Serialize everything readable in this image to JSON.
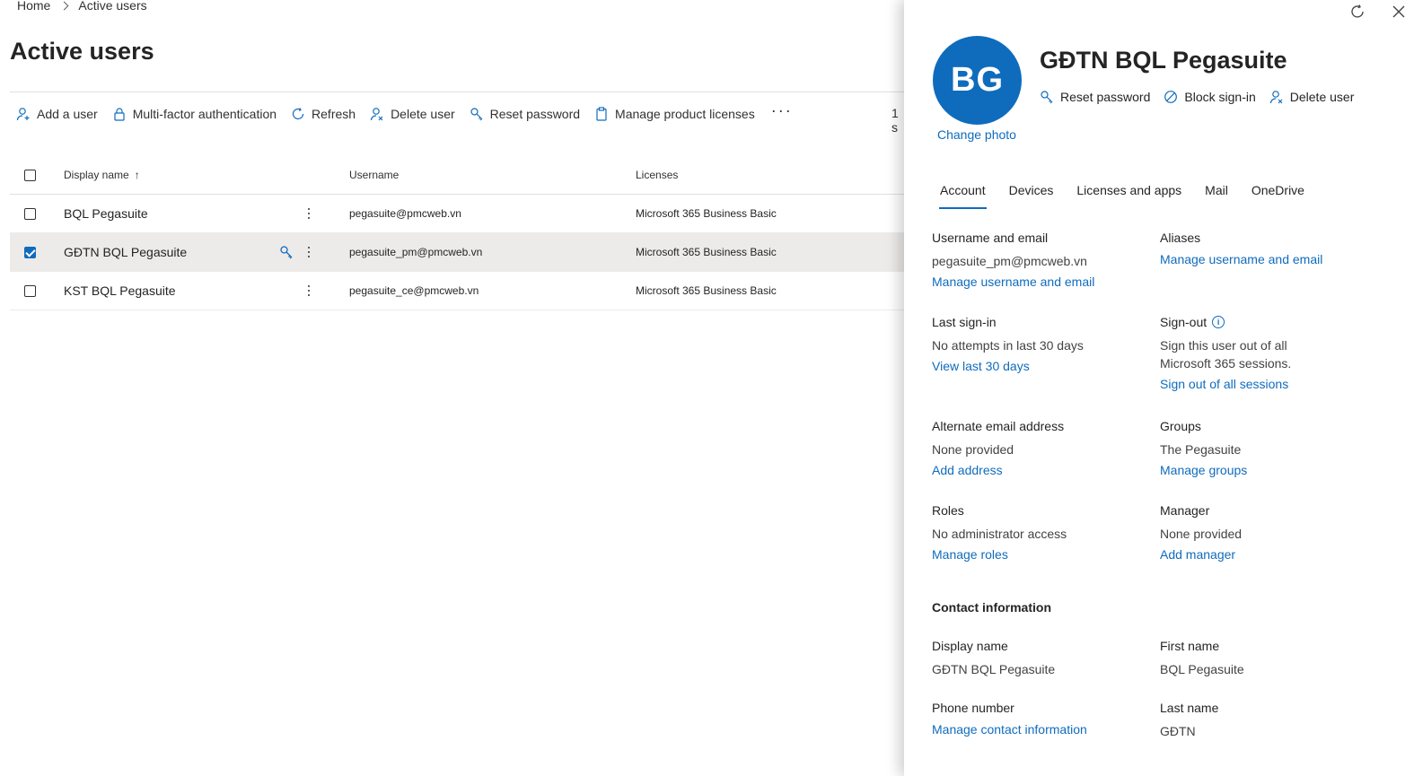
{
  "breadcrumb": {
    "home": "Home",
    "current": "Active users"
  },
  "page": {
    "title": "Active users"
  },
  "toolbar": {
    "add_user": "Add a user",
    "mfa": "Multi-factor authentication",
    "refresh": "Refresh",
    "delete_user": "Delete user",
    "reset_password": "Reset password",
    "manage_licenses": "Manage product licenses",
    "more": "···",
    "count": "1 s"
  },
  "table": {
    "headers": {
      "display_name": "Display name",
      "sort": "↑",
      "username": "Username",
      "licenses": "Licenses"
    },
    "rows": [
      {
        "name": "BQL Pegasuite",
        "username": "pegasuite@pmcweb.vn",
        "license": "Microsoft 365 Business Basic",
        "selected": false
      },
      {
        "name": "GĐTN BQL Pegasuite",
        "username": "pegasuite_pm@pmcweb.vn",
        "license": "Microsoft 365 Business Basic",
        "selected": true
      },
      {
        "name": "KST BQL Pegasuite",
        "username": "pegasuite_ce@pmcweb.vn",
        "license": "Microsoft 365 Business Basic",
        "selected": false
      }
    ]
  },
  "panel": {
    "avatar_initials": "BG",
    "change_photo": "Change photo",
    "user_name": "GĐTN BQL Pegasuite",
    "actions": {
      "reset_password": "Reset password",
      "block_signin": "Block sign-in",
      "delete_user": "Delete user"
    },
    "tabs": [
      "Account",
      "Devices",
      "Licenses and apps",
      "Mail",
      "OneDrive"
    ],
    "account": {
      "username_email": {
        "label": "Username and email",
        "value": "pegasuite_pm@pmcweb.vn",
        "link": "Manage username and email"
      },
      "aliases": {
        "label": "Aliases",
        "link": "Manage username and email"
      },
      "last_signin": {
        "label": "Last sign-in",
        "value": "No attempts in last 30 days",
        "link": "View last 30 days"
      },
      "signout": {
        "label": "Sign-out",
        "value": "Sign this user out of all Microsoft 365 sessions.",
        "link": "Sign out of all sessions"
      },
      "alt_email": {
        "label": "Alternate email address",
        "value": "None provided",
        "link": "Add address"
      },
      "groups": {
        "label": "Groups",
        "value": "The Pegasuite",
        "link": "Manage groups"
      },
      "roles": {
        "label": "Roles",
        "value": "No administrator access",
        "link": "Manage roles"
      },
      "manager": {
        "label": "Manager",
        "value": "None provided",
        "link": "Add manager"
      },
      "contact_title": "Contact information",
      "display_name": {
        "label": "Display name",
        "value": "GĐTN BQL Pegasuite"
      },
      "first_name": {
        "label": "First name",
        "value": "BQL Pegasuite"
      },
      "phone": {
        "label": "Phone number",
        "link": "Manage contact information"
      },
      "last_name": {
        "label": "Last name",
        "value": "GĐTN"
      }
    }
  },
  "colors": {
    "accent": "#0f6cbd",
    "selected_row": "#edebe9",
    "text": "#242424"
  }
}
